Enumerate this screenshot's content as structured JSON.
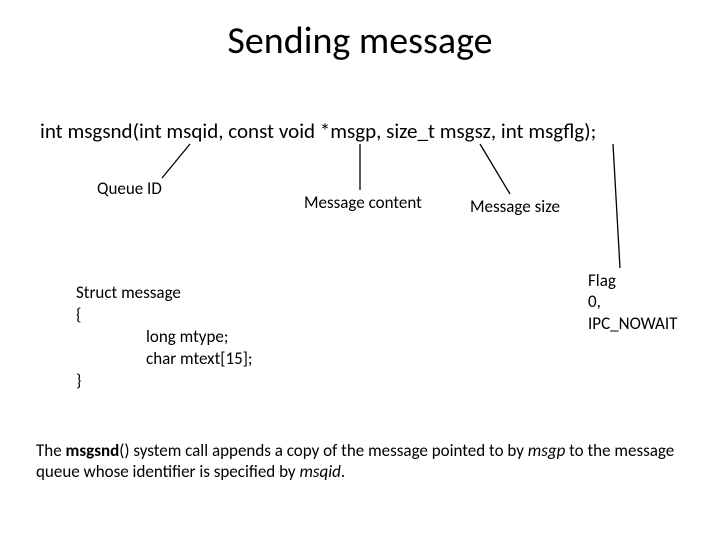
{
  "title": "Sending message",
  "signature": "int msgsnd(int msqid, const void *msgp, size_t msgsz, int msgflg);",
  "labels": {
    "queue_id": "Queue ID",
    "message_content": "Message content",
    "message_size": "Message size",
    "flag_line1": "Flag",
    "flag_line2": "0,",
    "flag_line3": "IPC_NOWAIT"
  },
  "struct": {
    "line1": "Struct message",
    "line2": "{",
    "line3": "long mtype;",
    "line4": "char mtext[15];",
    "line5": "}"
  },
  "desc": {
    "pre": "The ",
    "fn_bold": "msgsnd",
    "post_fn": "() system call appends a copy of the message pointed to by ",
    "msgp_it": "msgp",
    "mid": " to the message queue whose identifier is specified by ",
    "msqid_it": "msqid",
    "end": "."
  }
}
